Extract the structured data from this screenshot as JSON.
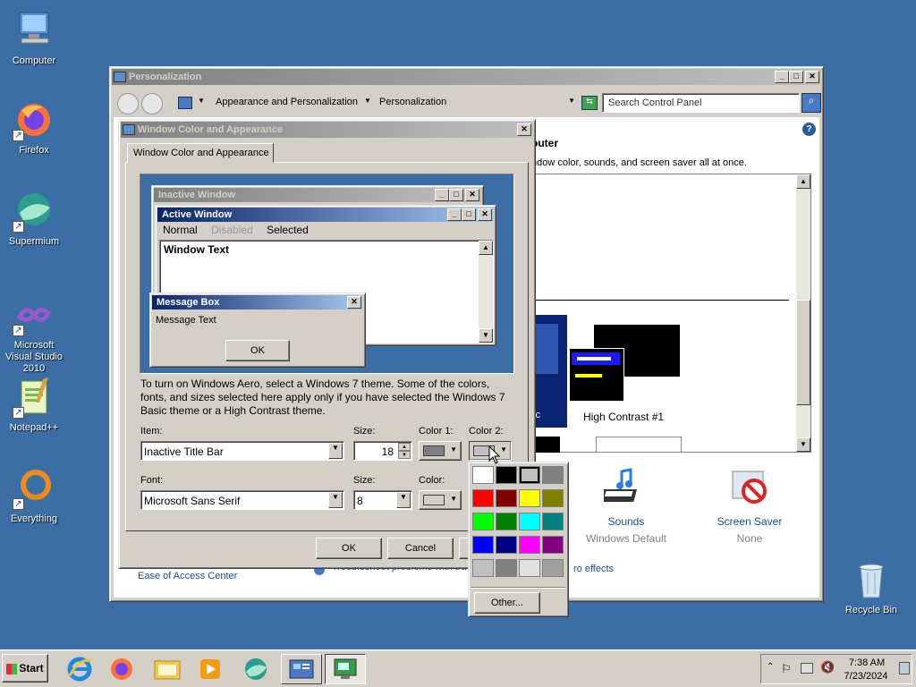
{
  "desktop": {
    "icons": [
      {
        "label": "Computer"
      },
      {
        "label": "Firefox"
      },
      {
        "label": "Supermium"
      },
      {
        "label": "Microsoft Visual Studio 2010"
      },
      {
        "label": "Notepad++"
      },
      {
        "label": "Everything"
      },
      {
        "label": "Recycle Bin"
      }
    ]
  },
  "personalization": {
    "title": "Personalization",
    "breadcrumb": [
      "Appearance and Personalization",
      "Personalization"
    ],
    "search_placeholder": "Search Control Panel",
    "heading_fragment": "puter",
    "desc_fragment": "ndow color, sounds, and screen saver all at once.",
    "theme_label_fragment": "ic",
    "theme_hc": "High Contrast #1",
    "sounds_label": "Sounds",
    "sounds_value": "Windows Default",
    "saver_label": "Screen Saver",
    "saver_value": "None",
    "ease_link": "Ease of Access Center",
    "troubleshoot_link": "Troubleshoot problems with tra",
    "effects_fragment": "ro effects"
  },
  "dialog": {
    "title": "Window Color and Appearance",
    "tab": "Window Color and Appearance",
    "preview": {
      "inactive_title": "Inactive Window",
      "active_title": "Active Window",
      "menu_normal": "Normal",
      "menu_disabled": "Disabled",
      "menu_selected": "Selected",
      "window_text": "Window Text",
      "msgbox_title": "Message Box",
      "msgbox_text": "Message Text",
      "msgbox_ok": "OK"
    },
    "info": "To turn on Windows Aero, select a Windows 7 theme.  Some of the colors, fonts, and sizes selected here apply only if you have selected the Windows 7 Basic theme or a High Contrast theme.",
    "item_label": "Item:",
    "item_value": "Inactive Title Bar",
    "size_label": "Size:",
    "size_value": "18",
    "color1_label": "Color 1:",
    "color2_label": "Color 2:",
    "font_label": "Font:",
    "font_value": "Microsoft Sans Serif",
    "font_size_label": "Size:",
    "font_size_value": "8",
    "font_color_label": "Color:",
    "ok": "OK",
    "cancel": "Cancel"
  },
  "color_picker": {
    "colors": [
      "#ffffff",
      "#000000",
      "#c0c0c0",
      "#808080",
      "#ff0000",
      "#800000",
      "#ffff00",
      "#808000",
      "#00ff00",
      "#008000",
      "#00ffff",
      "#008080",
      "#0000ff",
      "#000080",
      "#ff00ff",
      "#800080",
      "#c0c0c0",
      "#808080",
      "#e0e0e0",
      "#a0a0a0"
    ],
    "selected_index": 2,
    "other_label": "Other..."
  },
  "taskbar": {
    "start_label": "Start",
    "time": "7:38 AM",
    "date": "7/23/2024"
  }
}
